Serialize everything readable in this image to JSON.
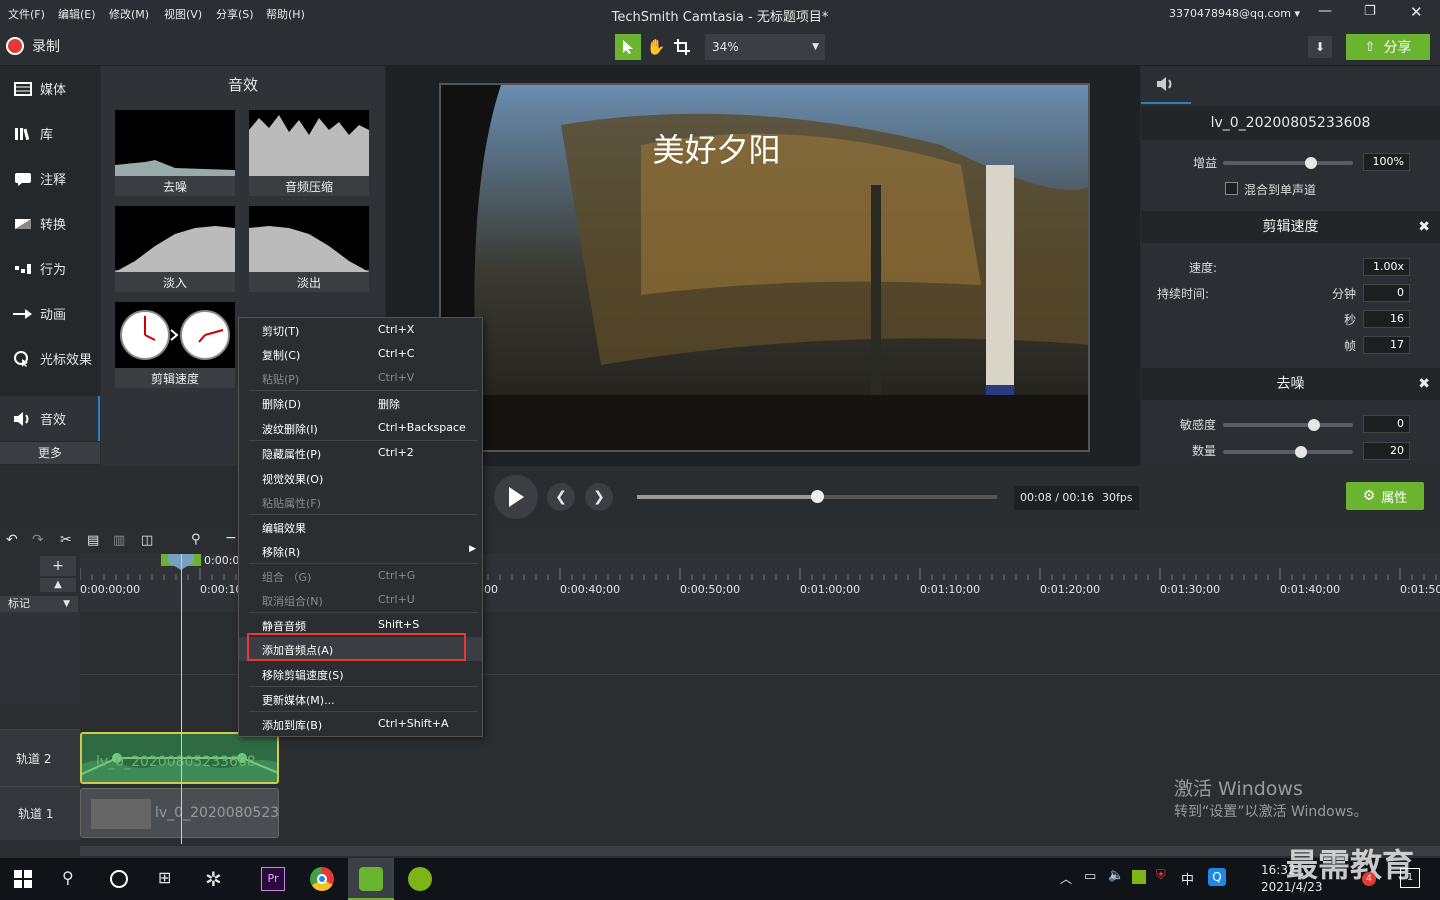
{
  "window": {
    "title": "TechSmith Camtasia - 无标题项目*",
    "account": "3370478948@qq.com",
    "menus": [
      "文件(F)",
      "编辑(E)",
      "修改(M)",
      "视图(V)",
      "分享(S)",
      "帮助(H)"
    ]
  },
  "toolbar": {
    "record_label": "录制",
    "zoom": "34%",
    "share_label": "分享"
  },
  "sidebar": {
    "items": [
      {
        "label": "媒体",
        "icon": "film-strip-icon"
      },
      {
        "label": "库",
        "icon": "library-icon"
      },
      {
        "label": "注释",
        "icon": "annotation-icon"
      },
      {
        "label": "转换",
        "icon": "transition-icon"
      },
      {
        "label": "行为",
        "icon": "behavior-icon"
      },
      {
        "label": "动画",
        "icon": "animation-icon"
      },
      {
        "label": "光标效果",
        "icon": "cursor-effect-icon"
      },
      {
        "label": "音效",
        "icon": "speaker-icon"
      }
    ],
    "more": "更多"
  },
  "library": {
    "title": "音效",
    "items": [
      "去噪",
      "音频压缩",
      "淡入",
      "淡出",
      "剪辑速度"
    ]
  },
  "preview": {
    "caption": "美好夕阳"
  },
  "properties": {
    "clip_name": "lv_0_20200805233608",
    "gain_label": "增益",
    "gain_value": "100%",
    "gain_level": 0.68,
    "mix_mono": "混合到单声道",
    "clip_speed_title": "剪辑速度",
    "speed_label": "速度:",
    "speed_value": "1.00x",
    "duration_label": "持续时间:",
    "minutes_label": "分钟",
    "minutes_value": "0",
    "seconds_label": "秒",
    "seconds_value": "16",
    "frames_label": "帧",
    "frames_value": "17",
    "denoise_title": "去噪",
    "sensitivity_label": "敏感度",
    "sensitivity_value": "0",
    "sensitivity_level": 0.7,
    "amount_label": "数量",
    "amount_value": "20",
    "amount_level": 0.6,
    "properties_button": "属性"
  },
  "playback": {
    "time": "00:08 / 00:16",
    "fps": "30fps",
    "progress": 0.5
  },
  "timeline": {
    "playhead_time": "0:00:0",
    "markers_label": "标记",
    "ruler": [
      "0:00:00;00",
      "0:00:10;",
      "00",
      "0:00:40;00",
      "0:00:50;00",
      "0:01:00;00",
      "0:01:10;00",
      "0:01:20;00",
      "0:01:30;00",
      "0:01:40;00",
      "0:01:50;"
    ],
    "tracks": [
      {
        "name": "轨道 2",
        "clip": "lv_0_20200805233608"
      },
      {
        "name": "轨道 1",
        "clip": "lv_0_2020080523"
      }
    ]
  },
  "context_menu": {
    "items": [
      {
        "label": "剪切(T)",
        "shortcut": "Ctrl+X",
        "disabled": false
      },
      {
        "label": "复制(C)",
        "shortcut": "Ctrl+C",
        "disabled": false
      },
      {
        "label": "粘贴(P)",
        "shortcut": "Ctrl+V",
        "disabled": true
      },
      {
        "label": "删除(D)",
        "shortcut": "删除",
        "disabled": false
      },
      {
        "label": "波纹删除(I)",
        "shortcut": "Ctrl+Backspace",
        "disabled": false
      },
      {
        "label": "隐藏属性(P)",
        "shortcut": "Ctrl+2",
        "disabled": false
      },
      {
        "label": "视觉效果(O)",
        "shortcut": "",
        "disabled": false
      },
      {
        "label": "粘贴属性(F)",
        "shortcut": "",
        "disabled": true
      },
      {
        "label": "编辑效果",
        "shortcut": "",
        "disabled": false
      },
      {
        "label": "移除(R)",
        "shortcut": "",
        "disabled": false
      },
      {
        "label": "组合 （G)",
        "shortcut": "Ctrl+G",
        "disabled": true
      },
      {
        "label": "取消组合(N)",
        "shortcut": "Ctrl+U",
        "disabled": true
      },
      {
        "label": "静音音频",
        "shortcut": "Shift+S",
        "disabled": false
      },
      {
        "label": "添加音频点(A)",
        "shortcut": "",
        "disabled": false
      },
      {
        "label": "移除剪辑速度(S)",
        "shortcut": "",
        "disabled": false
      },
      {
        "label": "更新媒体(M)...",
        "shortcut": "",
        "disabled": false
      },
      {
        "label": "添加到库(B)",
        "shortcut": "Ctrl+Shift+A",
        "disabled": false
      }
    ]
  },
  "watermark": {
    "line1": "激活 Windows",
    "line2": "转到“设置”以激活 Windows。",
    "brand": "最需教育"
  },
  "taskbar": {
    "time": "16:32",
    "date": "2021/4/23",
    "ime": "中",
    "notif_count": "4",
    "action_count": "1"
  },
  "colors": {
    "accent_green": "#6ab42f",
    "highlight_red": "#e53935",
    "selection_blue": "#2c7fc2"
  }
}
